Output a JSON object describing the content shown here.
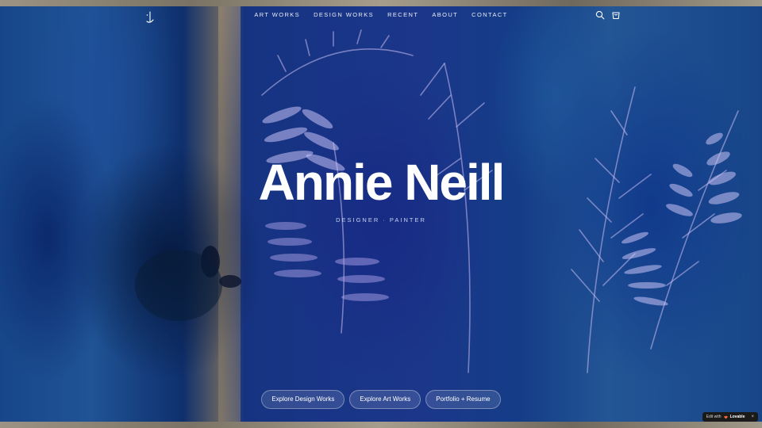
{
  "nav": {
    "items": [
      "ART WORKS",
      "DESIGN WORKS",
      "RECENT",
      "ABOUT",
      "CONTACT"
    ]
  },
  "header": {
    "icons": [
      "logo-icon",
      "search-icon",
      "cart-icon"
    ]
  },
  "hero": {
    "title": "Annie Neill",
    "subtitle": "DESIGNER · PAINTER"
  },
  "cta": {
    "design": "Explore Design Works",
    "art": "Explore Art Works",
    "portfolio": "Portfolio + Resume"
  },
  "badge": {
    "prefix": "Edit with",
    "brand": "Lovable",
    "close": "×"
  },
  "colors": {
    "accent": "#ffffff",
    "background_blue": "#1e4ea6",
    "subtitle": "#c9d3ee"
  }
}
